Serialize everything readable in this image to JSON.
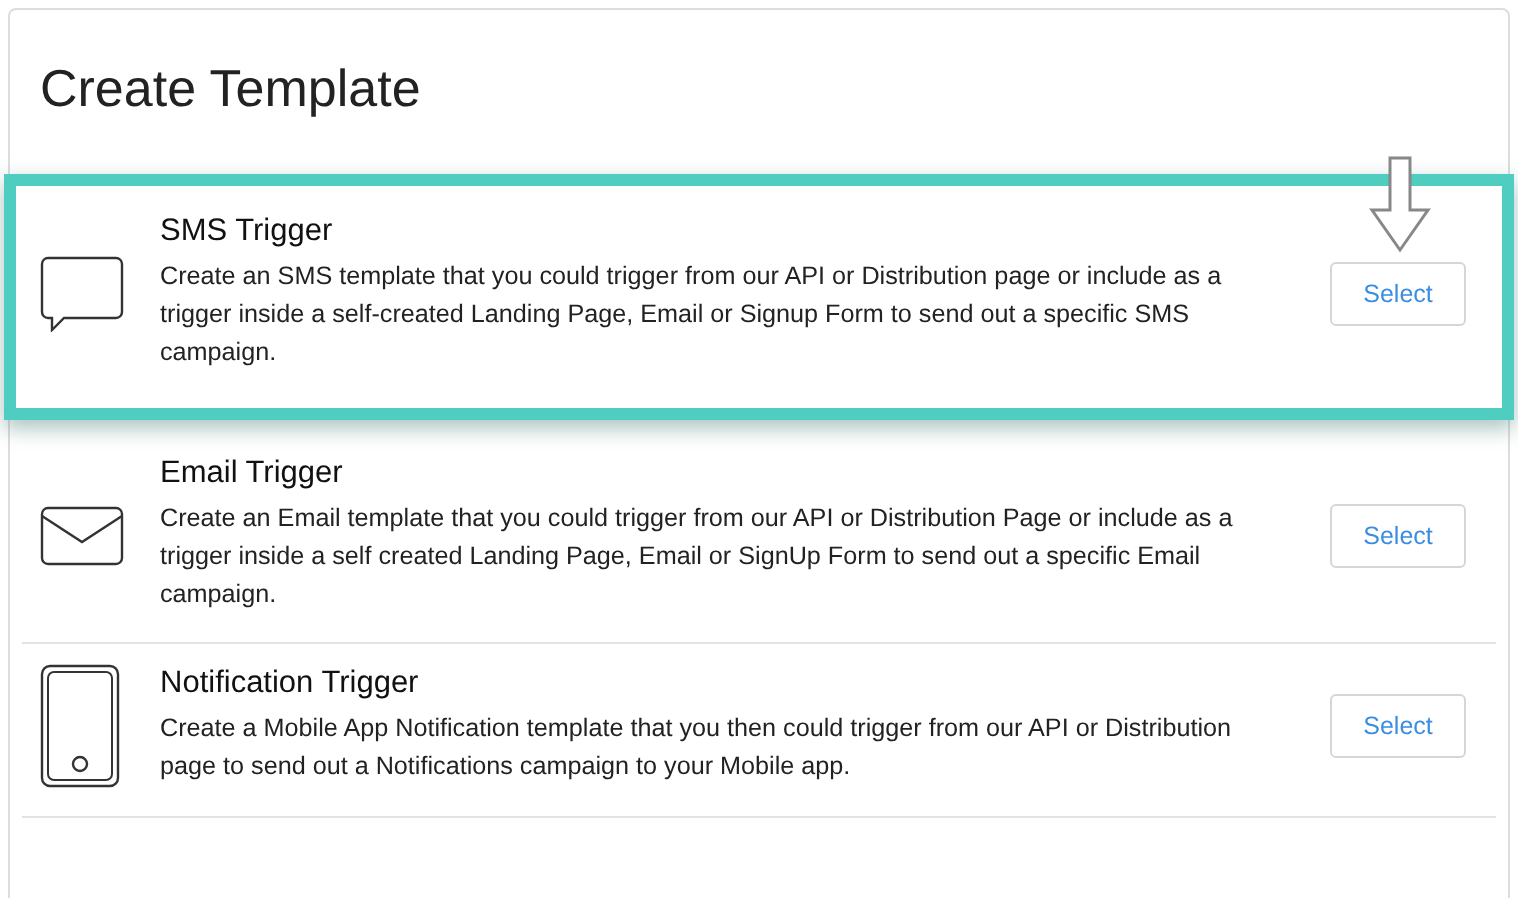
{
  "page": {
    "title": "Create Template"
  },
  "templates": [
    {
      "kind": "sms",
      "title": "SMS Trigger",
      "description": "Create an SMS template that you could trigger from our API or Distribution page or include as a trigger inside a self-created Landing Page, Email or Signup Form to send out a specific SMS campaign.",
      "button": "Select",
      "highlighted": true
    },
    {
      "kind": "email",
      "title": "Email Trigger",
      "description": "Create an Email template that you could trigger from our API or Distribution Page or include as a trigger inside a self created Landing Page, Email or SignUp Form to send out a specific Email campaign.",
      "button": "Select",
      "highlighted": false
    },
    {
      "kind": "notification",
      "title": "Notification Trigger",
      "description": "Create a Mobile App Notification template that you then could trigger from our API or Distribution page to send out a Notifications campaign to your Mobile app.",
      "button": "Select",
      "highlighted": false
    }
  ]
}
